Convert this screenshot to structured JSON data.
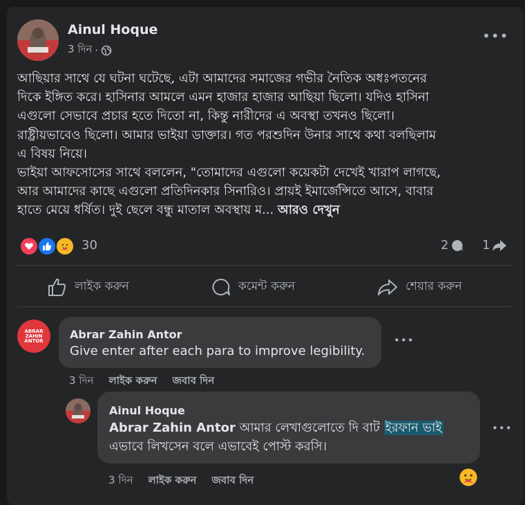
{
  "post": {
    "author": "Ainul Hoque",
    "time": "3 দিন",
    "separator": "·",
    "lines": [
      "আছিয়ার সাথে যে ঘটনা ঘটেছে, এটা আমাদের সমাজের গভীর নৈতিক অধঃপতনের",
      "দিকে ইঙ্গিত করে। হাসিনার আমলে এমন হাজার হাজার আছিয়া ছিলো। যদিও হাসিনা",
      "এগুলো সেভাবে প্রচার হতে দিতো না, কিন্তু নারীদের এ অবস্থা তখনও ছিলো।",
      "রাষ্ট্রীয়ভাবেও ছিলো। আমার ভাইয়া ডাক্তার। গত পরশুদিন উনার সাথে কথা বলছিলাম",
      "এ বিষয় নিয়ে।",
      "ভাইয়া আফসোসের সাথে বললেন, \"তোমাদের এগুলো কয়েকটা দেখেই খারাপ লাগছে,",
      "আর আমাদের কাছে এগুলো প্রতিদিনকার সিনারিও। প্রায়ই ইমার্জেন্সিতে আসে, বাবার"
    ],
    "last_line": "হাতে মেয়ে ধর্ষিত। দুই ছেলে বন্ধু মাতাল অবস্থায় ম...",
    "see_more": "আরও দেখুন",
    "reaction_count": "30",
    "comment_count": "2",
    "share_count": "1"
  },
  "actions": {
    "like": "লাইক করুন",
    "comment": "কমেন্ট করুন",
    "share": "শেয়ার করুন"
  },
  "comments": [
    {
      "author": "Abrar Zahin Antor",
      "avatar_text": "ABRAR ZAHIN ANTOR",
      "text": "Give enter after each para to improve legibility.",
      "time": "3 দিন",
      "like": "লাইক করুন",
      "reply": "জবাব দিন"
    }
  ],
  "reply": {
    "author": "Ainul Hoque",
    "mention": "Abrar Zahin Antor",
    "text_before": " আমার লেখাগুলোতে দি বাট ",
    "highlight": "ইরফান ভাই",
    "text_after": "এভাবে লিখসেন বলে এভাবেই পোস্ট করসি।",
    "time": "3 দিন",
    "like": "লাইক করুন",
    "reply": "জবাব দিন"
  },
  "colors": {
    "background": "#18191a",
    "card": "#242526",
    "bubble": "#3a3b3c",
    "like_blue": "#1877f2",
    "love_red": "#f33e58",
    "avatar_red": "#e0373d"
  },
  "icons": {
    "globe": "globe-icon",
    "more": "more-dots-icon",
    "love": "love-reaction-icon",
    "like": "like-reaction-icon",
    "care": "care-reaction-icon"
  }
}
